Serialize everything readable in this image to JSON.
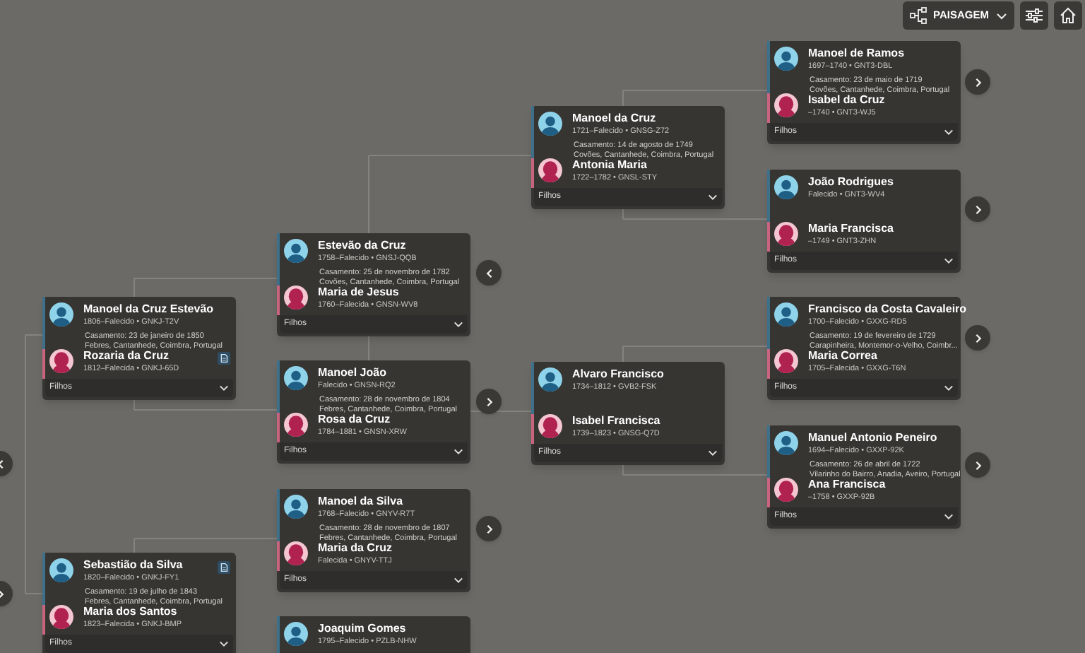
{
  "toolbar": {
    "view_label": "PAISAGEM"
  },
  "couples": [
    {
      "husband": {
        "name": "Manoel da Cruz Estevão",
        "info": "1806–Falecido • GNKJ-T2V"
      },
      "marriage": {
        "date": "Casamento: 23 de janeiro de 1850",
        "place": "Febres, Cantanhede, Coimbra, Portugal"
      },
      "wife": {
        "name": "Rozaria da Cruz",
        "info": "1812–Falecida • GNKJ-65D",
        "has_record": true
      },
      "children_label": "Filhos"
    },
    {
      "husband": {
        "name": "Sebastião da Silva",
        "info": "1820–Falecido • GNKJ-FY1",
        "has_record": true
      },
      "marriage": {
        "date": "Casamento: 19 de julho de 1843",
        "place": "Febres, Cantanhede, Coimbra, Portugal"
      },
      "wife": {
        "name": "Maria dos Santos",
        "info": "1823–Falecida • GNKJ-BMP"
      },
      "children_label": "Filhos"
    },
    {
      "husband": {
        "name": "Estevão da Cruz",
        "info": "1758–Falecido • GNSJ-QQB"
      },
      "marriage": {
        "date": "Casamento: 25 de novembro de 1782",
        "place": "Covões, Cantanhede, Coimbra, Portugal"
      },
      "wife": {
        "name": "Maria de Jesus",
        "info": "1760–Falecida • GNSN-WV8"
      },
      "children_label": "Filhos"
    },
    {
      "husband": {
        "name": "Manoel João",
        "info": "Falecido • GNSN-RQ2"
      },
      "marriage": {
        "date": "Casamento: 28 de novembro de 1804",
        "place": "Febres, Cantanhede, Coimbra, Portugal"
      },
      "wife": {
        "name": "Rosa da Cruz",
        "info": "1784–1881 • GNSN-XRW"
      },
      "children_label": "Filhos"
    },
    {
      "husband": {
        "name": "Manoel da Silva",
        "info": "1768–Falecido • GNYV-R7T"
      },
      "marriage": {
        "date": "Casamento: 28 de novembro de 1807",
        "place": "Febres, Cantanhede, Coimbra, Portugal"
      },
      "wife": {
        "name": "Maria da Cruz",
        "info": "Falecida • GNYV-TTJ"
      },
      "children_label": "Filhos"
    },
    {
      "husband": {
        "name": "Joaquim Gomes",
        "info": "1795–Falecido • PZLB-NHW"
      }
    },
    {
      "husband": {
        "name": "Manoel da Cruz",
        "info": "1721–Falecido • GNSG-Z72"
      },
      "marriage": {
        "date": "Casamento: 14 de agosto de 1749",
        "place": "Covões, Cantanhede, Coimbra, Portugal"
      },
      "wife": {
        "name": "Antonia Maria",
        "info": "1722–1782 • GNSL-STY"
      },
      "children_label": "Filhos"
    },
    {
      "husband": {
        "name": "Alvaro Francisco",
        "info": "1734–1812 • GVB2-FSK"
      },
      "wife": {
        "name": "Isabel Francisca",
        "info": "1739–1823 • GNSG-Q7D"
      },
      "children_label": "Filhos"
    },
    {
      "husband": {
        "name": "Manoel de Ramos",
        "info": "1697–1740 • GNT3-DBL"
      },
      "marriage": {
        "date": "Casamento: 23 de maio de 1719",
        "place": "Covões, Cantanhede, Coimbra, Portugal"
      },
      "wife": {
        "name": "Isabel da Cruz",
        "info": "–1740 • GNT3-WJ5"
      },
      "children_label": "Filhos"
    },
    {
      "husband": {
        "name": "João Rodrigues",
        "info": "Falecido • GNT3-WV4"
      },
      "wife": {
        "name": "Maria Francisca",
        "info": "–1749 • GNT3-ZHN"
      },
      "children_label": "Filhos"
    },
    {
      "husband": {
        "name": "Francisco da Costa Cavaleiro",
        "info": "1700–Falecido • GXXG-RD5"
      },
      "marriage": {
        "date": "Casamento: 19 de fevereiro de 1729",
        "place": "Carapinheira, Montemor-o-Velho, Coimbr..."
      },
      "wife": {
        "name": "Maria Correa",
        "info": "1705–Falecida • GXXG-T6N"
      },
      "children_label": "Filhos"
    },
    {
      "husband": {
        "name": "Manuel Antonio Peneiro",
        "info": "1694–Falecido • GXXP-92K"
      },
      "marriage": {
        "date": "Casamento: 26 de abril de 1722",
        "place": "Vilarinho do Bairro, Anadia, Aveiro, Portugal"
      },
      "wife": {
        "name": "Ana Francisca",
        "info": "–1758 • GXXP-92B"
      },
      "children_label": "Filhos"
    }
  ]
}
